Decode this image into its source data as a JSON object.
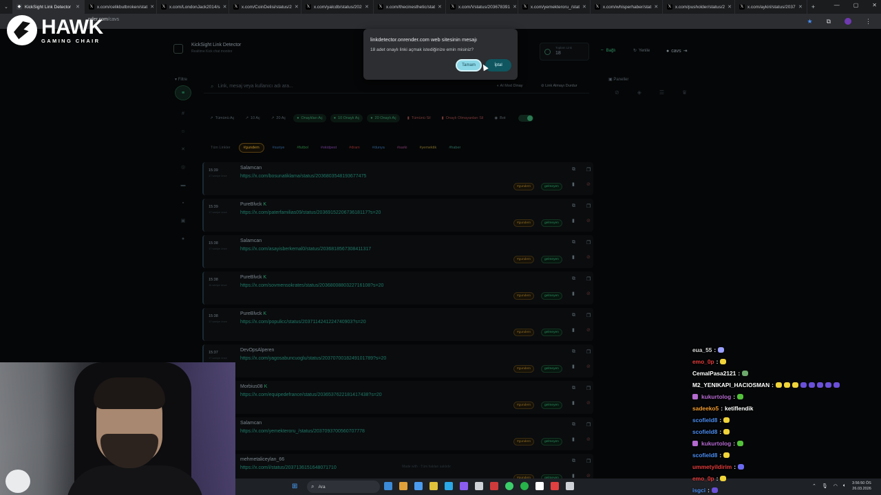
{
  "browser": {
    "tabs": [
      {
        "label": "KickSight Link Detector",
        "icon": "kicksight-icon",
        "active": true
      },
      {
        "label": "x.com/celikbutbroken/stat",
        "icon": "x-icon"
      },
      {
        "label": "x.com/LondonJack2014/s",
        "icon": "x-icon"
      },
      {
        "label": "x.com/CoinDelisi/status/2",
        "icon": "x-icon"
      },
      {
        "label": "x.com/yalcdb/status/202",
        "icon": "x-icon"
      },
      {
        "label": "x.com/thecinesthetic/stat",
        "icon": "x-icon"
      },
      {
        "label": "x.com/Vstatus/203678391",
        "icon": "x-icon"
      },
      {
        "label": "x.com/yemekteroru_/stat",
        "icon": "x-icon"
      },
      {
        "label": "x.com/whisperhaber/stat",
        "icon": "x-icon"
      },
      {
        "label": "x.com/pusholder/status/2",
        "icon": "x-icon"
      },
      {
        "label": "x.com/aykiri/status/2037",
        "icon": "x-icon"
      }
    ],
    "url_host": "nder.com",
    "url_path": "/cavs"
  },
  "overlay_logo": {
    "brand": "HAWK",
    "sub": "GAMING CHAIR"
  },
  "app": {
    "title": "KickSight Link Detector",
    "subtitle": "Realtime Kick chat monitor",
    "stat": {
      "label": "Toplam Link",
      "value": "18"
    },
    "header_buttons": {
      "status": "Bağlı",
      "refresh": "Yenile",
      "user": "cavs"
    },
    "filter_label": "Filtre",
    "search_placeholder": "Link, mesaj veya kullanıcı adı ara...",
    "search_options": {
      "ai_mode": "AI Mod Dinay",
      "stop": "Link Almayı Durdur"
    },
    "actions": {
      "open_all": "Tümünü Aç",
      "open10": "10 Aç",
      "open20": "20 Aç",
      "approved": "Onaylıları Aç",
      "approved10": "10 Onaylı Aç",
      "approved20": "20 Onaylı Aç",
      "delete_all": "Tümünü Sil",
      "delete_unapproved": "Onaylı Olmayanları Sil",
      "bot": "Bot"
    },
    "tags": [
      "Tüm Linkler",
      "#gundem",
      "#suriye",
      "#futbol",
      "#skidpest",
      "#dram",
      "#dunya",
      "#sarki",
      "#yemektik",
      "#haber"
    ],
    "panels_title": "Paneller",
    "footer_note": "Made with  ·  Tüm hakları saklıdır"
  },
  "feed": [
    {
      "time": "15:39",
      "ago": "17 saniye önce",
      "user": "Salamcan",
      "verified": false,
      "link": "https://x.com/bosunatiklama/status/2036803548193677475",
      "tag": "#gundem",
      "status": "gelmeyen"
    },
    {
      "time": "15:39",
      "ago": "17 saniye önce",
      "user": "PureBlvck",
      "verified": true,
      "link": "https://x.com/paterfamilias09/status/2036915220673618117?s=20",
      "tag": "#gundem",
      "status": "gelmeyen"
    },
    {
      "time": "15:38",
      "ago": "17 saniye önce",
      "user": "Salamcan",
      "verified": false,
      "link": "https://x.com/asayisberkemal0/status/2036818567308411317",
      "tag": "#gundem",
      "status": "gelmeyen"
    },
    {
      "time": "15:38",
      "ago": "1k saniye önce",
      "user": "PureBlvck",
      "verified": true,
      "link": "https://x.com/sovmensokrates/status/2036800880322716108?s=20",
      "tag": "#gundem",
      "status": "gelmeyen"
    },
    {
      "time": "15:38",
      "ago": "17 saniye önce",
      "user": "PureBlvck",
      "verified": true,
      "link": "https://x.com/populicc/status/2037114241224740903?s=20",
      "tag": "#gundem",
      "status": "gelmeyen"
    },
    {
      "time": "15:37",
      "ago": "17 saniye önce",
      "user": "DevOpsAlperen",
      "verified": false,
      "link": "https://x.com/yagosabuncuoglu/status/2037070018249101789?s=20",
      "tag": "#gundem",
      "status": "gelmeyen"
    },
    {
      "time": "",
      "ago": "",
      "user": "Morbius08",
      "verified": true,
      "link": "https://x.com/equipedefrance/status/2036537622181417438?s=20",
      "tag": "#gundem",
      "status": "gelmeyen"
    },
    {
      "time": "",
      "ago": "",
      "user": "Salamcan",
      "verified": false,
      "link": "https://x.com/yemekteroru_/status/2037093700560707778",
      "tag": "#gundem",
      "status": "gelmeyen"
    },
    {
      "time": "",
      "ago": "",
      "user": "mehmetaliceylan_66",
      "verified": false,
      "link": "https://x.com/i/status/2037136151648071710",
      "tag": "#gundem",
      "status": "gelmeyen"
    }
  ],
  "dialog": {
    "title": "linkdetector.onrender.com web sitesinin mesajı",
    "message": "18 adet onaylı linki açmak istediğinize emin misiniz?",
    "ok": "Tamam",
    "cancel": "İptal"
  },
  "chat": [
    {
      "user": "eua_55",
      "color": "#d6d6d6",
      "message": "",
      "emotes": [
        "#9aa0ff"
      ]
    },
    {
      "user": "emo_0p",
      "color": "#e23b3b",
      "message": "",
      "emotes": [
        "#f0d43a"
      ]
    },
    {
      "user": "CemalPasa2121",
      "color": "#ffffff",
      "message": "",
      "emotes": [
        "#6ca86c"
      ]
    },
    {
      "user": "M2_YENIKAPI_HACIOSMAN",
      "color": "#ffffff",
      "message": "",
      "emotes": [
        "#f0d43a",
        "#f0d43a",
        "#f0d43a",
        "#6a4fd8",
        "#6a4fd8",
        "#6a4fd8",
        "#6a4fd8",
        "#6a4fd8"
      ]
    },
    {
      "user": "kukurtolog",
      "color": "#b56ad0",
      "badge": true,
      "message": "",
      "emotes": [
        "#53c23b"
      ]
    },
    {
      "user": "sadeeko5",
      "color": "#f09a2e",
      "message": "ketiflendik",
      "emotes": []
    },
    {
      "user": "scofield8",
      "color": "#4a8cf0",
      "message": "",
      "emotes": [
        "#f0d43a"
      ]
    },
    {
      "user": "scofield8",
      "color": "#4a8cf0",
      "message": "",
      "emotes": [
        "#f0d43a"
      ]
    },
    {
      "user": "kukurtolog",
      "color": "#b56ad0",
      "badge": true,
      "message": "",
      "emotes": [
        "#53c23b"
      ]
    },
    {
      "user": "scofield8",
      "color": "#4a8cf0",
      "message": "",
      "emotes": [
        "#f0d43a"
      ]
    },
    {
      "user": "ummetyildirim",
      "color": "#e23b3b",
      "message": "",
      "emotes": [
        "#6a6af0"
      ]
    },
    {
      "user": "emo_0p",
      "color": "#e23b3b",
      "message": "",
      "emotes": [
        "#f0d43a"
      ]
    },
    {
      "user": "isgci",
      "color": "#4a8cf0",
      "message": "",
      "emotes": [
        "#6a4fd8"
      ]
    }
  ],
  "taskbar": {
    "search_label": "Ara",
    "time": "3:56:50 ÖS",
    "date": "26.03.2026",
    "app_colors": [
      "#3b8bd8",
      "#e0a13a",
      "#4b9cf0",
      "#e0c23a",
      "#2aa8e8",
      "#8a5cf0",
      "#cfd3d7",
      "#cf3b3b",
      "#3bcf6a",
      "#27b24a",
      "#ffffff",
      "#e04040",
      "#cfd3d7"
    ]
  }
}
